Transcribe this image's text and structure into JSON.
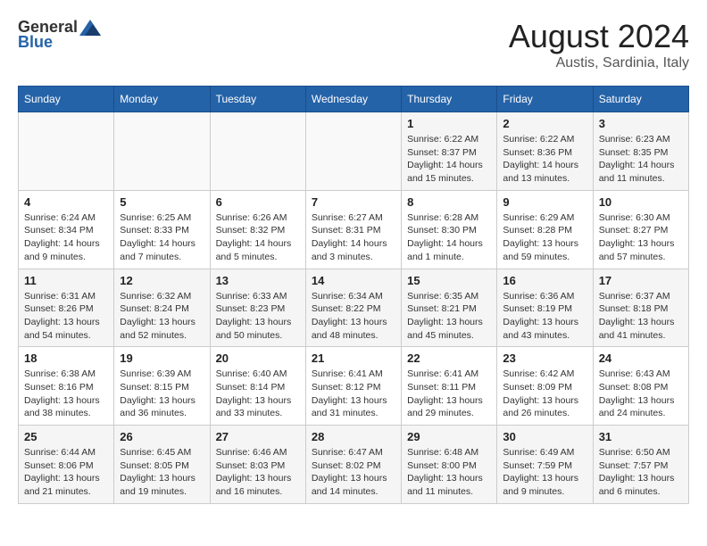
{
  "header": {
    "logo": {
      "general": "General",
      "blue": "Blue"
    },
    "title": "August 2024",
    "subtitle": "Austis, Sardinia, Italy"
  },
  "calendar": {
    "weekdays": [
      "Sunday",
      "Monday",
      "Tuesday",
      "Wednesday",
      "Thursday",
      "Friday",
      "Saturday"
    ],
    "weeks": [
      [
        {
          "day": "",
          "info": ""
        },
        {
          "day": "",
          "info": ""
        },
        {
          "day": "",
          "info": ""
        },
        {
          "day": "",
          "info": ""
        },
        {
          "day": "1",
          "info": "Sunrise: 6:22 AM\nSunset: 8:37 PM\nDaylight: 14 hours and 15 minutes."
        },
        {
          "day": "2",
          "info": "Sunrise: 6:22 AM\nSunset: 8:36 PM\nDaylight: 14 hours and 13 minutes."
        },
        {
          "day": "3",
          "info": "Sunrise: 6:23 AM\nSunset: 8:35 PM\nDaylight: 14 hours and 11 minutes."
        }
      ],
      [
        {
          "day": "4",
          "info": "Sunrise: 6:24 AM\nSunset: 8:34 PM\nDaylight: 14 hours and 9 minutes."
        },
        {
          "day": "5",
          "info": "Sunrise: 6:25 AM\nSunset: 8:33 PM\nDaylight: 14 hours and 7 minutes."
        },
        {
          "day": "6",
          "info": "Sunrise: 6:26 AM\nSunset: 8:32 PM\nDaylight: 14 hours and 5 minutes."
        },
        {
          "day": "7",
          "info": "Sunrise: 6:27 AM\nSunset: 8:31 PM\nDaylight: 14 hours and 3 minutes."
        },
        {
          "day": "8",
          "info": "Sunrise: 6:28 AM\nSunset: 8:30 PM\nDaylight: 14 hours and 1 minute."
        },
        {
          "day": "9",
          "info": "Sunrise: 6:29 AM\nSunset: 8:28 PM\nDaylight: 13 hours and 59 minutes."
        },
        {
          "day": "10",
          "info": "Sunrise: 6:30 AM\nSunset: 8:27 PM\nDaylight: 13 hours and 57 minutes."
        }
      ],
      [
        {
          "day": "11",
          "info": "Sunrise: 6:31 AM\nSunset: 8:26 PM\nDaylight: 13 hours and 54 minutes."
        },
        {
          "day": "12",
          "info": "Sunrise: 6:32 AM\nSunset: 8:24 PM\nDaylight: 13 hours and 52 minutes."
        },
        {
          "day": "13",
          "info": "Sunrise: 6:33 AM\nSunset: 8:23 PM\nDaylight: 13 hours and 50 minutes."
        },
        {
          "day": "14",
          "info": "Sunrise: 6:34 AM\nSunset: 8:22 PM\nDaylight: 13 hours and 48 minutes."
        },
        {
          "day": "15",
          "info": "Sunrise: 6:35 AM\nSunset: 8:21 PM\nDaylight: 13 hours and 45 minutes."
        },
        {
          "day": "16",
          "info": "Sunrise: 6:36 AM\nSunset: 8:19 PM\nDaylight: 13 hours and 43 minutes."
        },
        {
          "day": "17",
          "info": "Sunrise: 6:37 AM\nSunset: 8:18 PM\nDaylight: 13 hours and 41 minutes."
        }
      ],
      [
        {
          "day": "18",
          "info": "Sunrise: 6:38 AM\nSunset: 8:16 PM\nDaylight: 13 hours and 38 minutes."
        },
        {
          "day": "19",
          "info": "Sunrise: 6:39 AM\nSunset: 8:15 PM\nDaylight: 13 hours and 36 minutes."
        },
        {
          "day": "20",
          "info": "Sunrise: 6:40 AM\nSunset: 8:14 PM\nDaylight: 13 hours and 33 minutes."
        },
        {
          "day": "21",
          "info": "Sunrise: 6:41 AM\nSunset: 8:12 PM\nDaylight: 13 hours and 31 minutes."
        },
        {
          "day": "22",
          "info": "Sunrise: 6:41 AM\nSunset: 8:11 PM\nDaylight: 13 hours and 29 minutes."
        },
        {
          "day": "23",
          "info": "Sunrise: 6:42 AM\nSunset: 8:09 PM\nDaylight: 13 hours and 26 minutes."
        },
        {
          "day": "24",
          "info": "Sunrise: 6:43 AM\nSunset: 8:08 PM\nDaylight: 13 hours and 24 minutes."
        }
      ],
      [
        {
          "day": "25",
          "info": "Sunrise: 6:44 AM\nSunset: 8:06 PM\nDaylight: 13 hours and 21 minutes."
        },
        {
          "day": "26",
          "info": "Sunrise: 6:45 AM\nSunset: 8:05 PM\nDaylight: 13 hours and 19 minutes."
        },
        {
          "day": "27",
          "info": "Sunrise: 6:46 AM\nSunset: 8:03 PM\nDaylight: 13 hours and 16 minutes."
        },
        {
          "day": "28",
          "info": "Sunrise: 6:47 AM\nSunset: 8:02 PM\nDaylight: 13 hours and 14 minutes."
        },
        {
          "day": "29",
          "info": "Sunrise: 6:48 AM\nSunset: 8:00 PM\nDaylight: 13 hours and 11 minutes."
        },
        {
          "day": "30",
          "info": "Sunrise: 6:49 AM\nSunset: 7:59 PM\nDaylight: 13 hours and 9 minutes."
        },
        {
          "day": "31",
          "info": "Sunrise: 6:50 AM\nSunset: 7:57 PM\nDaylight: 13 hours and 6 minutes."
        }
      ]
    ]
  }
}
